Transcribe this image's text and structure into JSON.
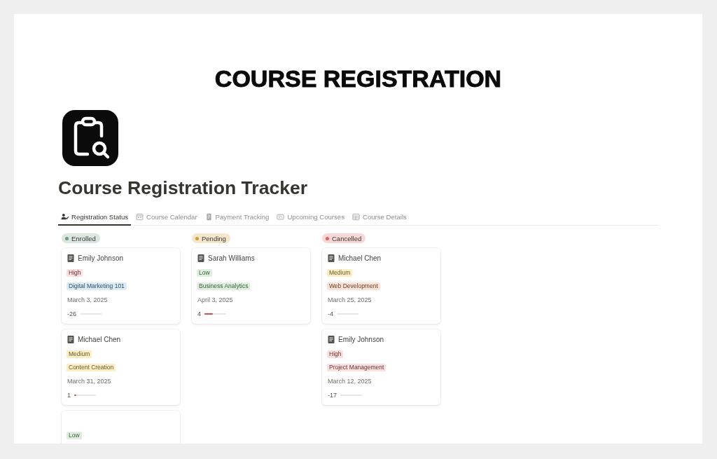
{
  "banner": {
    "title": "COURSE REGISTRATION"
  },
  "page": {
    "title": "Course Registration Tracker"
  },
  "tabs": [
    {
      "label": "Registration Status",
      "selected": true
    },
    {
      "label": "Course Calendar",
      "selected": false
    },
    {
      "label": "Payment Tracking",
      "selected": false
    },
    {
      "label": "Upcoming Courses",
      "selected": false
    },
    {
      "label": "Course Details",
      "selected": false
    }
  ],
  "columns": [
    {
      "status": "Enrolled",
      "color": "#6c9b7d",
      "cards": [
        {
          "name": "Emily Johnson",
          "priority": {
            "label": "High",
            "color": "#fbe0e0"
          },
          "course": {
            "label": "Digital Marketing 101",
            "color": "#dbeaf4"
          },
          "date": "March 3, 2025",
          "progress": {
            "reading": "-26",
            "level": 0
          }
        },
        {
          "name": "Michael Chen",
          "priority": {
            "label": "Medium",
            "color": "#fbedc4"
          },
          "course": {
            "label": "Content Creation",
            "color": "#fbedc4"
          },
          "date": "March 31, 2025",
          "progress": {
            "reading": "1",
            "level": 0.1
          }
        },
        {
          "priority": {
            "label": "Low",
            "color": "#e2ede2"
          }
        }
      ]
    },
    {
      "status": "Pending",
      "color": "#d49a2e",
      "cards": [
        {
          "name": "Sarah Williams",
          "priority": {
            "label": "Low",
            "color": "#e2ede2"
          },
          "course": {
            "label": "Business Analytics",
            "color": "#e2ede2"
          },
          "date": "April 3, 2025",
          "progress": {
            "reading": "4",
            "level": 0.4
          }
        }
      ]
    },
    {
      "status": "Cancelled",
      "color": "#e06359",
      "cards": [
        {
          "name": "Michael Chen",
          "priority": {
            "label": "Medium",
            "color": "#fbedc4"
          },
          "course": {
            "label": "Web Development",
            "color": "#fbe2d6"
          },
          "date": "March 25, 2025",
          "progress": {
            "reading": "-4",
            "level": 0
          }
        },
        {
          "name": "Emily Johnson",
          "priority": {
            "label": "High",
            "color": "#fbe0e0"
          },
          "course": {
            "label": "Project Management",
            "color": "#fbe0e0"
          },
          "date": "March 12, 2025",
          "progress": {
            "reading": "-17",
            "level": 0
          }
        }
      ]
    }
  ]
}
